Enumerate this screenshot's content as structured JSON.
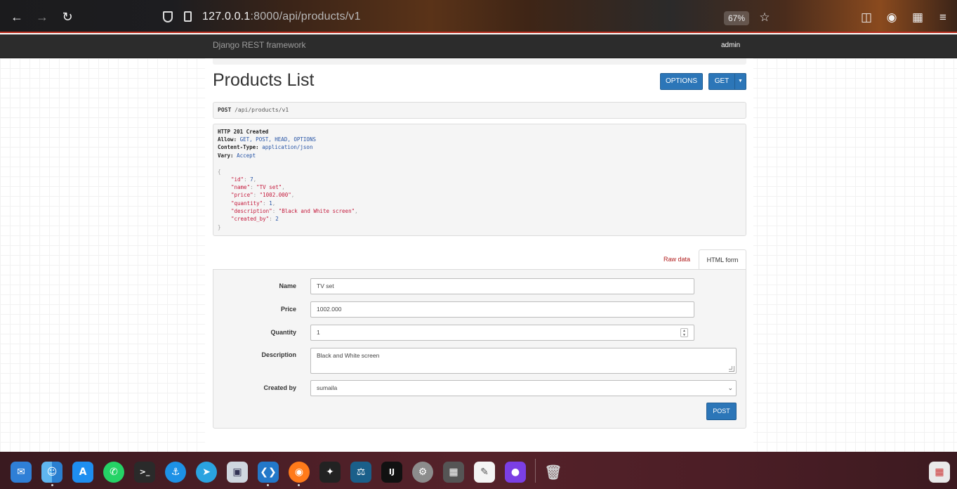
{
  "browser": {
    "url_host": "127.0.0.1",
    "url_rest": ":8000/api/products/v1",
    "zoom": "67%"
  },
  "navbar": {
    "brand": "Django REST framework",
    "user": "admin"
  },
  "page": {
    "title": "Products List",
    "options_label": "OPTIONS",
    "get_label": "GET"
  },
  "request": {
    "method": "POST",
    "path": "/api/products/v1"
  },
  "response": {
    "status": "HTTP 201 Created",
    "allow_key": "Allow:",
    "allow_val": "GET, POST, HEAD, OPTIONS",
    "ctype_key": "Content-Type:",
    "ctype_val": "application/json",
    "vary_key": "Vary:",
    "vary_val": "Accept",
    "open_brace": "{",
    "close_brace": "}",
    "fields": [
      {
        "key": "\"id\"",
        "value": "7",
        "kind": "num",
        "comma": ","
      },
      {
        "key": "\"name\"",
        "value": "\"TV set\"",
        "kind": "str",
        "comma": ","
      },
      {
        "key": "\"price\"",
        "value": "\"1002.000\"",
        "kind": "str",
        "comma": ","
      },
      {
        "key": "\"quantity\"",
        "value": "1",
        "kind": "num",
        "comma": ","
      },
      {
        "key": "\"description\"",
        "value": "\"Black and White screen\"",
        "kind": "str",
        "comma": ","
      },
      {
        "key": "\"created_by\"",
        "value": "2",
        "kind": "num",
        "comma": ""
      }
    ]
  },
  "tabs": {
    "raw": "Raw data",
    "html": "HTML form"
  },
  "form": {
    "name_label": "Name",
    "name_value": "TV set",
    "price_label": "Price",
    "price_value": "1002.000",
    "quantity_label": "Quantity",
    "quantity_value": "1",
    "description_label": "Description",
    "description_value": "Black and White screen",
    "created_by_label": "Created by",
    "created_by_value": "sumaila",
    "post_label": "POST"
  },
  "dock": {
    "items": [
      "mail-app",
      "finder-app",
      "app-store",
      "whatsapp-app",
      "terminal-app",
      "docker-app",
      "telegram-app",
      "preview-app",
      "vscode-app",
      "firefox-app",
      "resolve-app",
      "mysql-workbench-app",
      "intellij-app",
      "system-settings-app",
      "calculator-app",
      "textedit-app",
      "screen-recorder-app",
      "trash",
      "launchpad-app"
    ]
  }
}
